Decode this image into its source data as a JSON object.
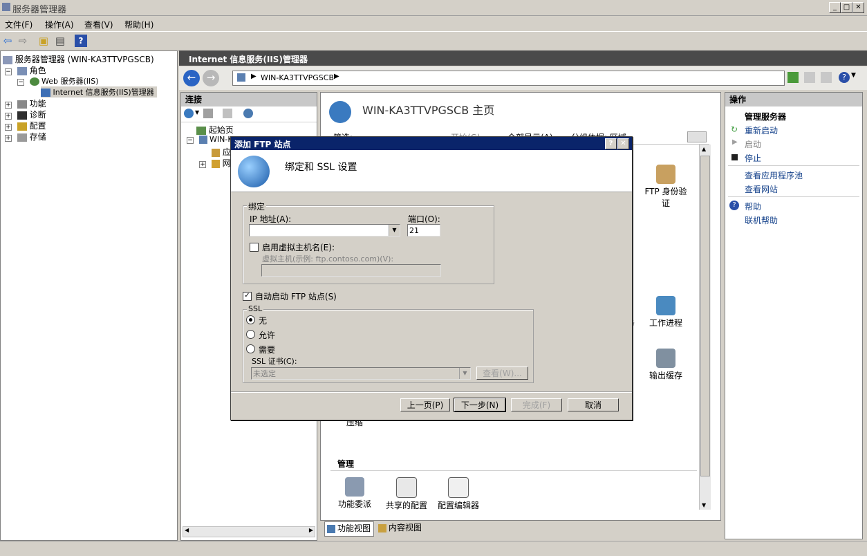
{
  "window": {
    "title": "服务器管理器"
  },
  "menu": [
    "文件(F)",
    "操作(A)",
    "查看(V)",
    "帮助(H)"
  ],
  "tree": {
    "root": "服务器管理器 (WIN-KA3TTVPGSCB)",
    "roles": "角色",
    "web_server": "Web 服务器(IIS)",
    "iis_manager": "Internet 信息服务(IIS)管理器",
    "features": "功能",
    "diagnostics": "诊断",
    "config": "配置",
    "storage": "存储"
  },
  "iis": {
    "header": "Internet 信息服务(IIS)管理器",
    "address": "WIN-KA3TTVPGSCB",
    "connections_title": "连接",
    "conn_items": [
      "起始页",
      "WIN-K",
      "应",
      "网"
    ],
    "home_title": "WIN-KA3TTVPGSCB 主页",
    "filter_label": "筛选:",
    "filter_start": "开始(G)",
    "filter_showall": "全部显示(A)",
    "filter_group": "分组依据: 区域",
    "features": {
      "ftp_auth": "FTP 身份验证",
      "work_process": "工作进程",
      "output_cache": "输出缓存",
      "compress": "压缩",
      "manage_title": "管理",
      "delegation": "功能委派",
      "shared_config": "共享的配置",
      "config_editor": "配置编辑器"
    },
    "view_tabs": [
      "功能视图",
      "内容视图"
    ],
    "partial_text": "务"
  },
  "actions": {
    "title": "操作",
    "manage_server": "管理服务器",
    "restart": "重新启动",
    "start": "启动",
    "stop": "停止",
    "view_app_pools": "查看应用程序池",
    "view_sites": "查看网站",
    "help": "帮助",
    "online_help": "联机帮助"
  },
  "dialog": {
    "title": "添加 FTP 站点",
    "heading": "绑定和 SSL 设置",
    "binding_group": "绑定",
    "ip_label": "IP 地址(A):",
    "ip_value": "",
    "port_label": "端口(O):",
    "port_value": "21",
    "vhost_check": "启用虚拟主机名(E):",
    "vhost_label": "虚拟主机(示例: ftp.contoso.com)(V):",
    "vhost_value": "",
    "autostart": "自动启动 FTP 站点(S)",
    "ssl_group": "SSL",
    "ssl_none": "无",
    "ssl_allow": "允许",
    "ssl_require": "需要",
    "cert_label": "SSL 证书(C):",
    "cert_value": "未选定",
    "view_btn": "查看(W)...",
    "back_btn": "上一页(P)",
    "next_btn": "下一步(N)",
    "finish_btn": "完成(F)",
    "cancel_btn": "取消",
    "help_btn": "?",
    "close_btn": "✕"
  }
}
